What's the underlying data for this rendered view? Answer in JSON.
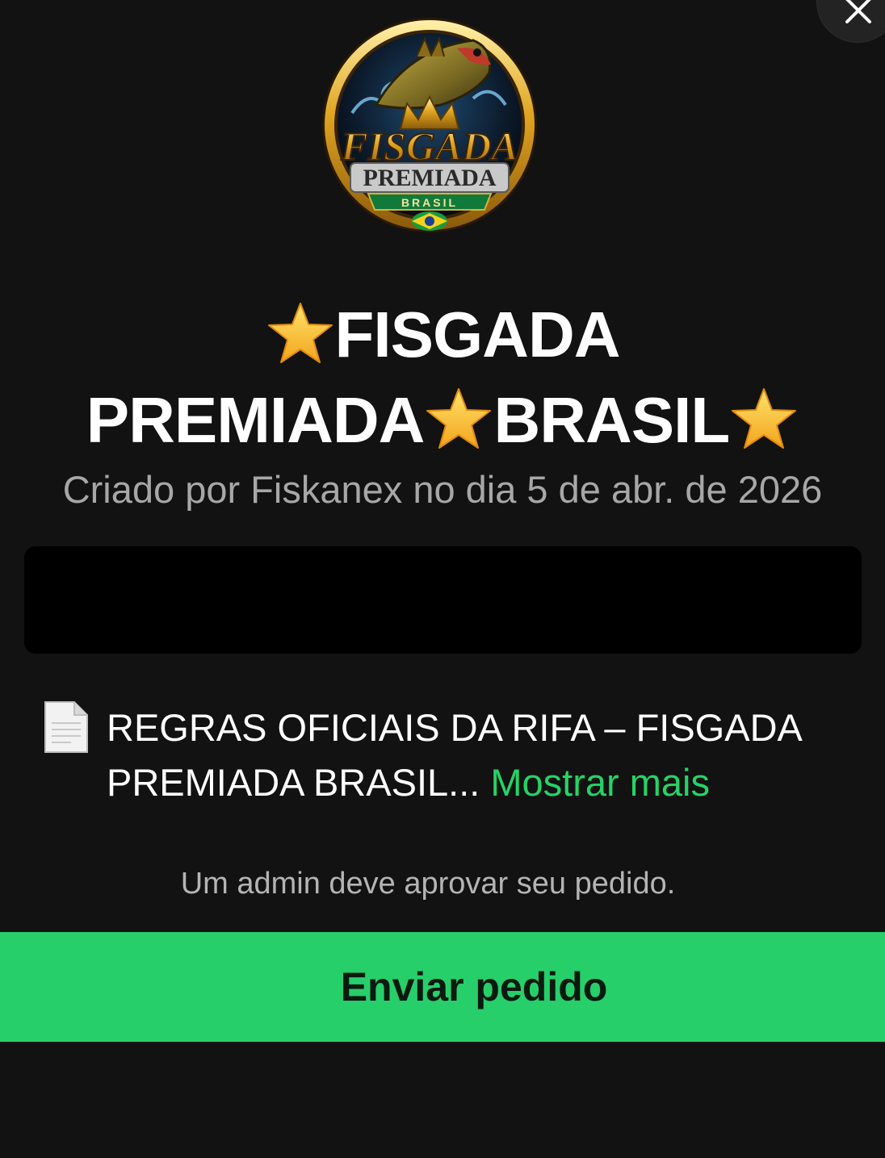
{
  "close_button": {
    "icon": "close-icon"
  },
  "group": {
    "avatar": {
      "logo_line1": "FISGADA",
      "logo_line2": "PREMIADA",
      "logo_line3": "BRASIL"
    },
    "title_line1": "FISGADA",
    "title_line2_a": "PREMIADA",
    "title_line2_b": "BRASIL",
    "title_icon": "star-icon",
    "created_by": "Criado por Fiskanex no dia 5 de abr. de 2026"
  },
  "description": {
    "icon": "document-icon",
    "text": "REGRAS OFICIAIS DA RIFA – FISGADA PREMIADA BRASIL...",
    "show_more_label": "Mostrar mais"
  },
  "admin_note": "Um admin deve aprovar seu pedido.",
  "send_button": {
    "label": "Enviar pedido"
  },
  "colors": {
    "background": "#121212",
    "accent_green": "#25d366",
    "button_green": "#27cf6a",
    "muted_text": "#a7a7a7"
  }
}
